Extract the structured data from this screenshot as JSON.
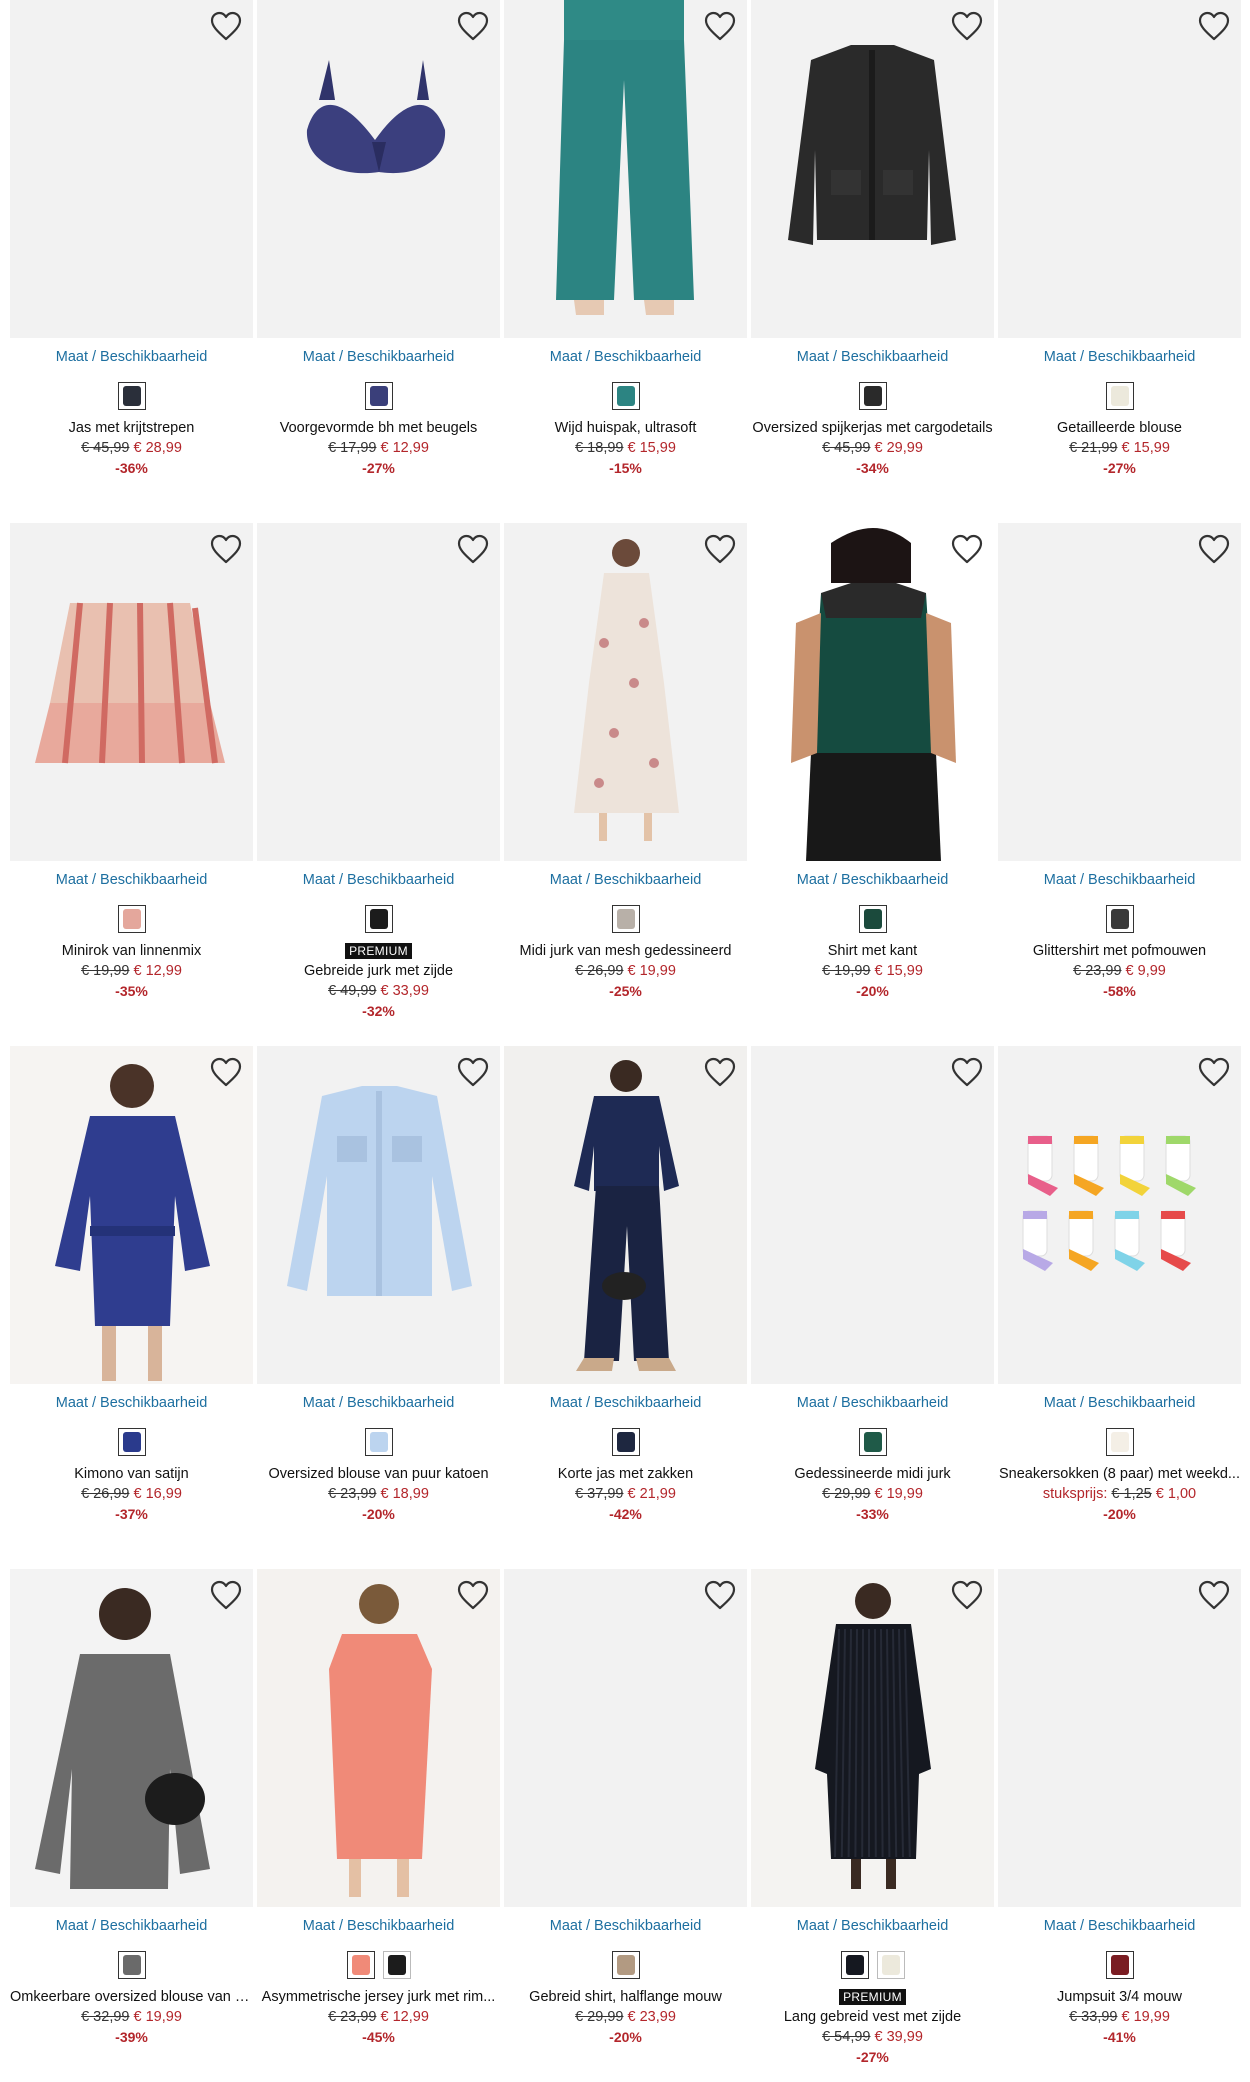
{
  "colors": {
    "link": "#1d6fa0",
    "sale": "#b3262b",
    "placeholder": "#f2f2f2"
  },
  "size_link_label": "Maat / Beschikbaarheid",
  "premium_label": "PREMIUM",
  "products": [
    {
      "name": "Jas met krijtstrepen",
      "old_price": "€ 45,99",
      "new_price": "€ 28,99",
      "discount": "-36%",
      "image": "blank",
      "swatches": [
        "#2a2f3a"
      ]
    },
    {
      "name": "Voorgevormde bh met beugels",
      "old_price": "€ 17,99",
      "new_price": "€ 12,99",
      "discount": "-27%",
      "image": "bra",
      "swatches": [
        "#3a3f7a"
      ]
    },
    {
      "name": "Wijd huispak, ultrasoft",
      "old_price": "€ 18,99",
      "new_price": "€ 15,99",
      "discount": "-15%",
      "image": "pants",
      "swatches": [
        "#2c8482"
      ]
    },
    {
      "name": "Oversized spijkerjas met cargodetails",
      "old_price": "€ 45,99",
      "new_price": "€ 29,99",
      "discount": "-34%",
      "image": "jacket",
      "swatches": [
        "#2a2a2a"
      ]
    },
    {
      "name": "Getailleerde blouse",
      "old_price": "€ 21,99",
      "new_price": "€ 15,99",
      "discount": "-27%",
      "image": "blank",
      "swatches": [
        "#ece9dc"
      ]
    },
    {
      "name": "Minirok van linnenmix",
      "old_price": "€ 19,99",
      "new_price": "€ 12,99",
      "discount": "-35%",
      "image": "skirt",
      "swatches": [
        "#e4a79c"
      ]
    },
    {
      "name": "Gebreide jurk met zijde",
      "old_price": "€ 49,99",
      "new_price": "€ 33,99",
      "discount": "-32%",
      "image": "blank",
      "swatches": [
        "#1c1c1c"
      ],
      "premium": true
    },
    {
      "name": "Midi jurk van mesh gedessineerd",
      "old_price": "€ 26,99",
      "new_price": "€ 19,99",
      "discount": "-25%",
      "image": "floral-dress",
      "swatches": [
        "#b8b0a8"
      ]
    },
    {
      "name": "Shirt met kant",
      "old_price": "€ 19,99",
      "new_price": "€ 15,99",
      "discount": "-20%",
      "image": "lace-top",
      "swatches": [
        "#1b4a3c"
      ]
    },
    {
      "name": "Glittershirt met pofmouwen",
      "old_price": "€ 23,99",
      "new_price": "€ 9,99",
      "discount": "-58%",
      "image": "blank",
      "swatches": [
        "#3a3a3a"
      ]
    },
    {
      "name": "Kimono van satijn",
      "old_price": "€ 26,99",
      "new_price": "€ 16,99",
      "discount": "-37%",
      "image": "kimono",
      "swatches": [
        "#2a3a8c"
      ]
    },
    {
      "name": "Oversized blouse van puur katoen",
      "old_price": "€ 23,99",
      "new_price": "€ 18,99",
      "discount": "-20%",
      "image": "blue-blouse",
      "swatches": [
        "#bcd4ef"
      ]
    },
    {
      "name": "Korte jas met zakken",
      "old_price": "€ 37,99",
      "new_price": "€ 21,99",
      "discount": "-42%",
      "image": "denim-set",
      "swatches": [
        "#1e2740"
      ]
    },
    {
      "name": "Gedessineerde midi jurk",
      "old_price": "€ 29,99",
      "new_price": "€ 19,99",
      "discount": "-33%",
      "image": "blank",
      "swatches": [
        "#1f5a48"
      ]
    },
    {
      "name": "Sneakersokken (8 paar) met weekd...",
      "unit_label": "stuksprijs:",
      "old_price": "€ 1,25",
      "new_price": "€ 1,00",
      "discount": "-20%",
      "image": "socks",
      "swatches": [
        "#f4efe6"
      ]
    },
    {
      "name": "Omkeerbare oversized blouse van v...",
      "old_price": "€ 32,99",
      "new_price": "€ 19,99",
      "discount": "-39%",
      "image": "grey-blouse",
      "swatches": [
        "#6a6a6a"
      ]
    },
    {
      "name": "Asymmetrische jersey jurk met rim...",
      "old_price": "€ 23,99",
      "new_price": "€ 12,99",
      "discount": "-45%",
      "image": "coral-dress",
      "swatches": [
        "#f08a78",
        "#1c1c1c"
      ]
    },
    {
      "name": "Gebreid shirt, halflange mouw",
      "old_price": "€ 29,99",
      "new_price": "€ 23,99",
      "discount": "-20%",
      "image": "blank",
      "swatches": [
        "#b29a82"
      ]
    },
    {
      "name": "Lang gebreid vest met zijde",
      "old_price": "€ 54,99",
      "new_price": "€ 39,99",
      "discount": "-27%",
      "image": "knit-cardigan",
      "swatches": [
        "#151820",
        "#ece9dc"
      ],
      "premium": true
    },
    {
      "name": "Jumpsuit 3/4 mouw",
      "old_price": "€ 33,99",
      "new_price": "€ 19,99",
      "discount": "-41%",
      "image": "blank",
      "swatches": [
        "#7a1c22"
      ]
    }
  ]
}
